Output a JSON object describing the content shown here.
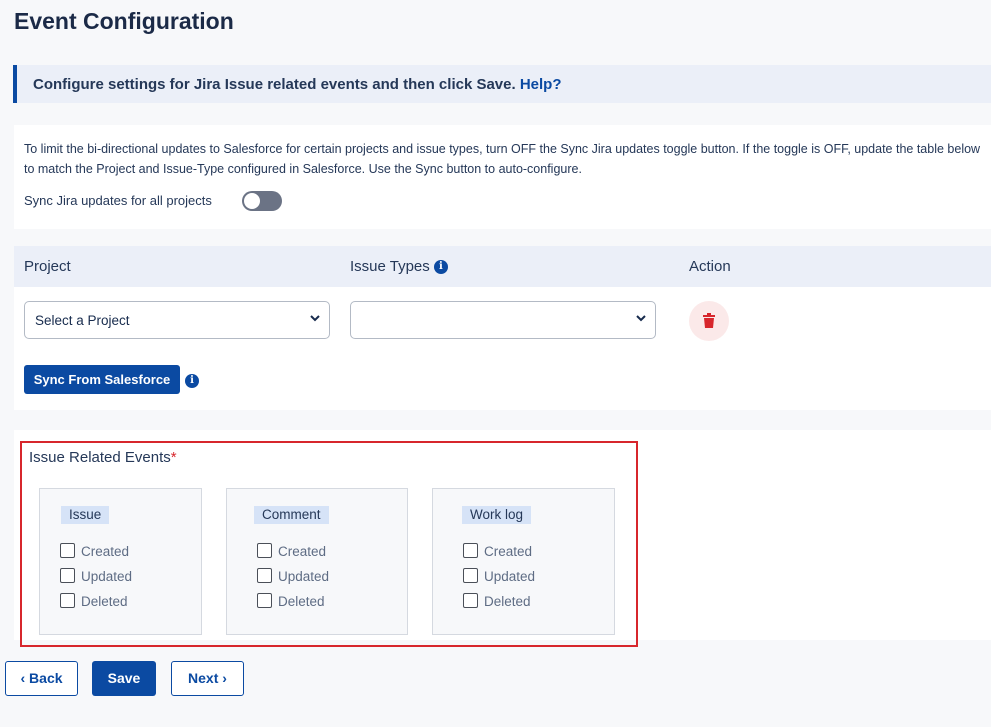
{
  "page": {
    "title": "Event Configuration"
  },
  "banner": {
    "text": "Configure settings for Jira Issue related events and then click Save.",
    "help_link": "Help?"
  },
  "sync_settings": {
    "description": "To limit the bi-directional updates to Salesforce for certain projects and issue types, turn OFF the Sync Jira updates toggle button. If the toggle is OFF, update the table below to match the Project and Issue-Type configured in Salesforce. Use the Sync button to auto-configure.",
    "toggle_label": "Sync Jira updates for all projects",
    "toggle_on": false
  },
  "mapping": {
    "columns": {
      "project": "Project",
      "issue_types": "Issue Types",
      "action": "Action"
    },
    "project_select_value": "Select a Project",
    "issue_types_select_value": "",
    "sync_button": "Sync From Salesforce"
  },
  "events": {
    "title": "Issue Related Events",
    "required_mark": "*",
    "groups": [
      {
        "label": "Issue",
        "options": [
          "Created",
          "Updated",
          "Deleted"
        ]
      },
      {
        "label": "Comment",
        "options": [
          "Created",
          "Updated",
          "Deleted"
        ]
      },
      {
        "label": "Work log",
        "options": [
          "Created",
          "Updated",
          "Deleted"
        ]
      }
    ]
  },
  "footer": {
    "back": "Back",
    "save": "Save",
    "next": "Next"
  },
  "colors": {
    "primary": "#0b4aa2",
    "required": "#d7262c",
    "delete_bg": "#fbe9e9"
  }
}
